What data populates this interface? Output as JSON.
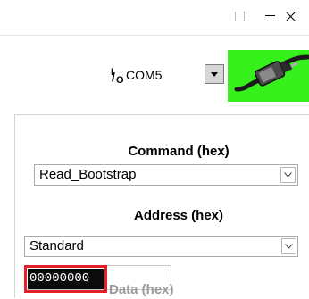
{
  "window": {
    "controls": [
      "minimize",
      "maximize",
      "close"
    ]
  },
  "port": {
    "io_icon": "io-icon",
    "io_glyph_i": "I",
    "io_glyph_slash": "/",
    "io_glyph_o": "O",
    "value": "COM5",
    "connect_icon": "plug-cable-icon",
    "connect_color": "#35f01a"
  },
  "command": {
    "label": "Command (hex)",
    "value": "Read_Bootstrap"
  },
  "address": {
    "label": "Address (hex)",
    "mode": "Standard",
    "value": "00000000"
  },
  "data": {
    "label": "Data (hex)"
  },
  "colors": {
    "highlight": "#e5202a",
    "connect_green": "#35f01a"
  }
}
